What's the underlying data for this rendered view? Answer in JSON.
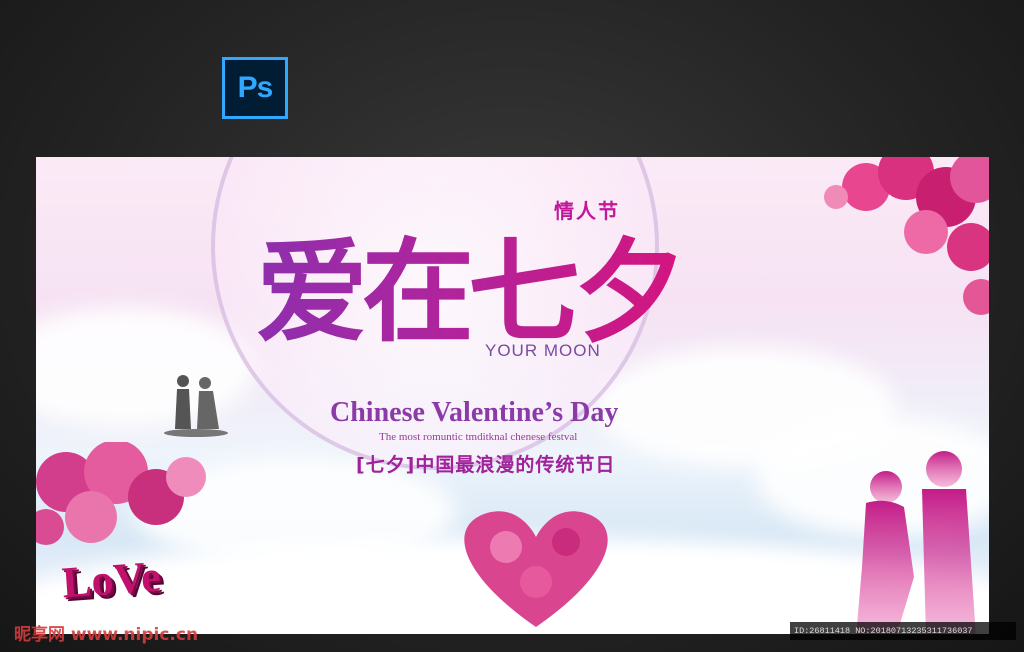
{
  "app": {
    "badge_label": "Ps"
  },
  "poster": {
    "tag": "情人节",
    "main_title": "爱在七夕",
    "subtitle_en": "YOUR MOON",
    "headline_en": "Chinese Valentine’s Day",
    "tagline_en": "The most romuntic tmditknal chenese festval",
    "slogan_cn": "[七夕]中国最浪漫的传统节日",
    "love_word": "LoVe"
  },
  "watermark": {
    "site": "昵享网 www.nipic.cn",
    "id_text": "ID:26811418 NO:20180713235311736037"
  },
  "colors": {
    "accent": "#b0249c",
    "pink": "#e0408f",
    "purple": "#8b3aa8",
    "ps_blue": "#31a8ff"
  }
}
